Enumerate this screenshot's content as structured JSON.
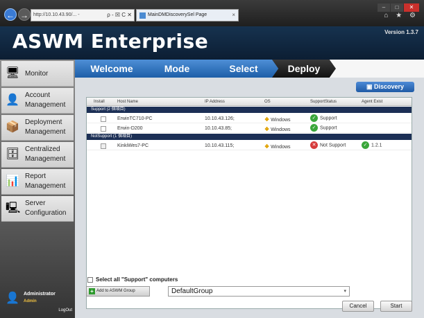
{
  "browser": {
    "address": "http://10.10.43.90/...  - ",
    "address_controls": "ρ - ☒ C ✕",
    "tab_title": "MainDMDiscoverySel Page",
    "tab_close": "×",
    "nav_back": "←",
    "nav_forward": "→",
    "toolbar_icons": "⌂ ★ ⚙"
  },
  "app": {
    "title": "ASWM Enterprise",
    "version": "Version 1.3.7"
  },
  "sidebar": {
    "items": [
      {
        "label": "Monitor",
        "icon": "monitor-icon",
        "glyph": "🖥"
      },
      {
        "label": "Account Management",
        "icon": "account-icon",
        "glyph": "👤"
      },
      {
        "label": "Deployment Management",
        "icon": "deployment-icon",
        "glyph": "📦"
      },
      {
        "label": "Centralized Management",
        "icon": "centralized-icon",
        "glyph": "🗄"
      },
      {
        "label": "Report Management",
        "icon": "report-icon",
        "glyph": "📊"
      },
      {
        "label": "Server Configuration",
        "icon": "server-icon",
        "glyph": "🖳"
      }
    ],
    "user": {
      "name": "Administrator",
      "role": "Admin",
      "logout": "LogOut"
    }
  },
  "wizard": {
    "steps": [
      "Welcome",
      "Mode",
      "Select",
      "Deploy"
    ],
    "discovery_button": "Discovery"
  },
  "table": {
    "headers": [
      "Install",
      "Host Name",
      "IP Address",
      "OS",
      "SupportStatus",
      "Agent Exist"
    ],
    "groups": [
      {
        "label": "Support (2 個項目)",
        "rows": [
          {
            "host": "ErwinTC710-PC",
            "ip": "10.10.43.126;",
            "os": "Windows",
            "status": "Support",
            "status_kind": "ok",
            "agent": ""
          },
          {
            "host": "Erwin-D200",
            "ip": "10.10.43.85;",
            "os": "Windows",
            "status": "Support",
            "status_kind": "ok",
            "agent": ""
          }
        ]
      },
      {
        "label": "NotSupport (1 個項目)",
        "rows": [
          {
            "host": "KinkiWes7-PC",
            "ip": "10.10.43.115;",
            "os": "Windows",
            "status": "Not Support",
            "status_kind": "no",
            "agent": "1.2.1"
          }
        ]
      }
    ]
  },
  "footer": {
    "select_all": "Select all \"Support\" computers",
    "add_button": "Add to ASWM Group",
    "group_value": "DefaultGroup",
    "cancel": "Cancel",
    "start": "Start"
  },
  "colors": {
    "header_bg": "#16324f",
    "step_blue": "#1d5ea8",
    "step_active": "#111111",
    "group_bar": "#1c2f55"
  }
}
